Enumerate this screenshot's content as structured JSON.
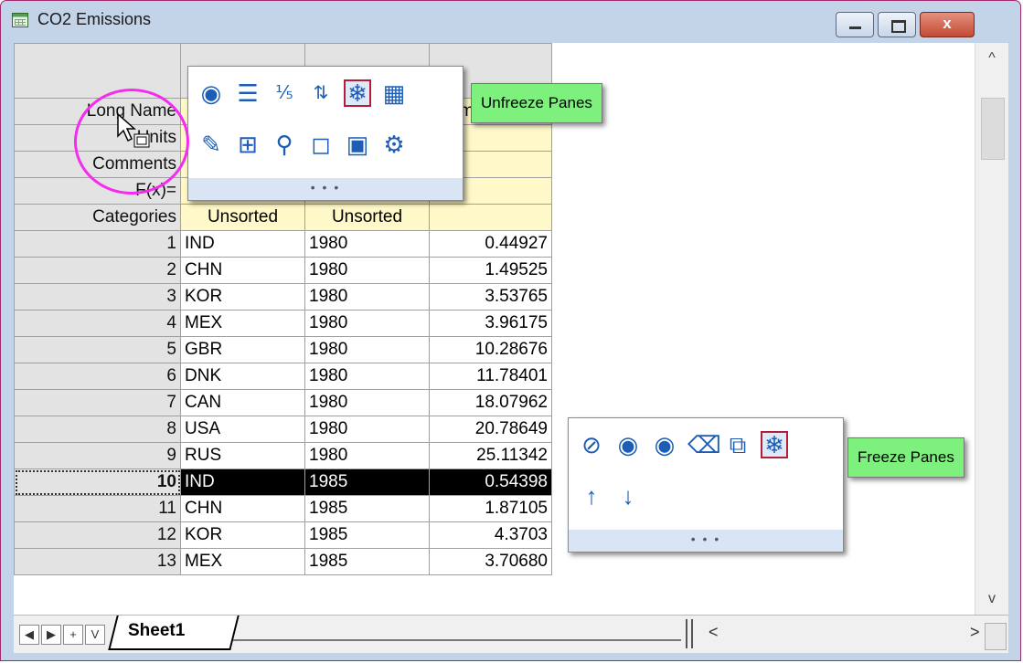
{
  "window": {
    "title": "CO2 Emissions",
    "close_glyph": "x"
  },
  "corner_label": "",
  "header_rows": [
    {
      "label": "Long Name",
      "cells": [
        "",
        "",
        "2 Emis"
      ]
    },
    {
      "label": "Units",
      "cells": [
        "",
        "",
        ""
      ]
    },
    {
      "label": "Comments",
      "cells": [
        "",
        "",
        ""
      ]
    },
    {
      "label": "F(x)=",
      "cells": [
        "",
        "",
        ""
      ]
    },
    {
      "label": "Categories",
      "cells": [
        "Unsorted",
        "Unsorted",
        ""
      ]
    }
  ],
  "rows": [
    {
      "n": "1",
      "country": "IND",
      "year": "1980",
      "value": "0.44927"
    },
    {
      "n": "2",
      "country": "CHN",
      "year": "1980",
      "value": "1.49525"
    },
    {
      "n": "3",
      "country": "KOR",
      "year": "1980",
      "value": "3.53765"
    },
    {
      "n": "4",
      "country": "MEX",
      "year": "1980",
      "value": "3.96175"
    },
    {
      "n": "5",
      "country": "GBR",
      "year": "1980",
      "value": "10.28676"
    },
    {
      "n": "6",
      "country": "DNK",
      "year": "1980",
      "value": "11.78401"
    },
    {
      "n": "7",
      "country": "CAN",
      "year": "1980",
      "value": "18.07962"
    },
    {
      "n": "8",
      "country": "USA",
      "year": "1980",
      "value": "20.78649"
    },
    {
      "n": "9",
      "country": "RUS",
      "year": "1980",
      "value": "25.11342"
    },
    {
      "n": "10",
      "country": "IND",
      "year": "1985",
      "value": "0.54398"
    },
    {
      "n": "11",
      "country": "CHN",
      "year": "1985",
      "value": "1.87105"
    },
    {
      "n": "12",
      "country": "KOR",
      "year": "1985",
      "value": "4.3703"
    },
    {
      "n": "13",
      "country": "MEX",
      "year": "1985",
      "value": "3.70680"
    }
  ],
  "selected_row": "10",
  "toolbar_top": {
    "icons_row1": [
      "show-icon",
      "list-icon",
      "formula-icon",
      "sort-icon",
      "freeze-icon",
      "grid-icon"
    ],
    "icons_row2": [
      "highlight-icon",
      "insert-icon",
      "search-icon",
      "comment-icon",
      "lock-icon",
      "settings-icon"
    ],
    "tooltip": "Unfreeze Panes",
    "more": "• • •"
  },
  "toolbar_bottom": {
    "icons_row1": [
      "hide-icon",
      "show-icon",
      "mask-icon",
      "delete-icon",
      "copy-icon",
      "freeze-icon"
    ],
    "icons_row2": [
      "sort-ascending-icon",
      "sort-descending-icon"
    ],
    "tooltip": "Freeze Panes",
    "more": "• • •"
  },
  "sheet_tab": "Sheet1",
  "nav": {
    "first": "◀",
    "next": "▶",
    "add": "+",
    "list": "V"
  },
  "scroll": {
    "up": "^",
    "down": "v",
    "left": "<",
    "right": ">"
  },
  "colors": {
    "accent": "#1c5db5",
    "highlight_ring": "#f32cf0",
    "tooltip_bg": "#7ef07e",
    "active_border": "#b21d3a"
  }
}
